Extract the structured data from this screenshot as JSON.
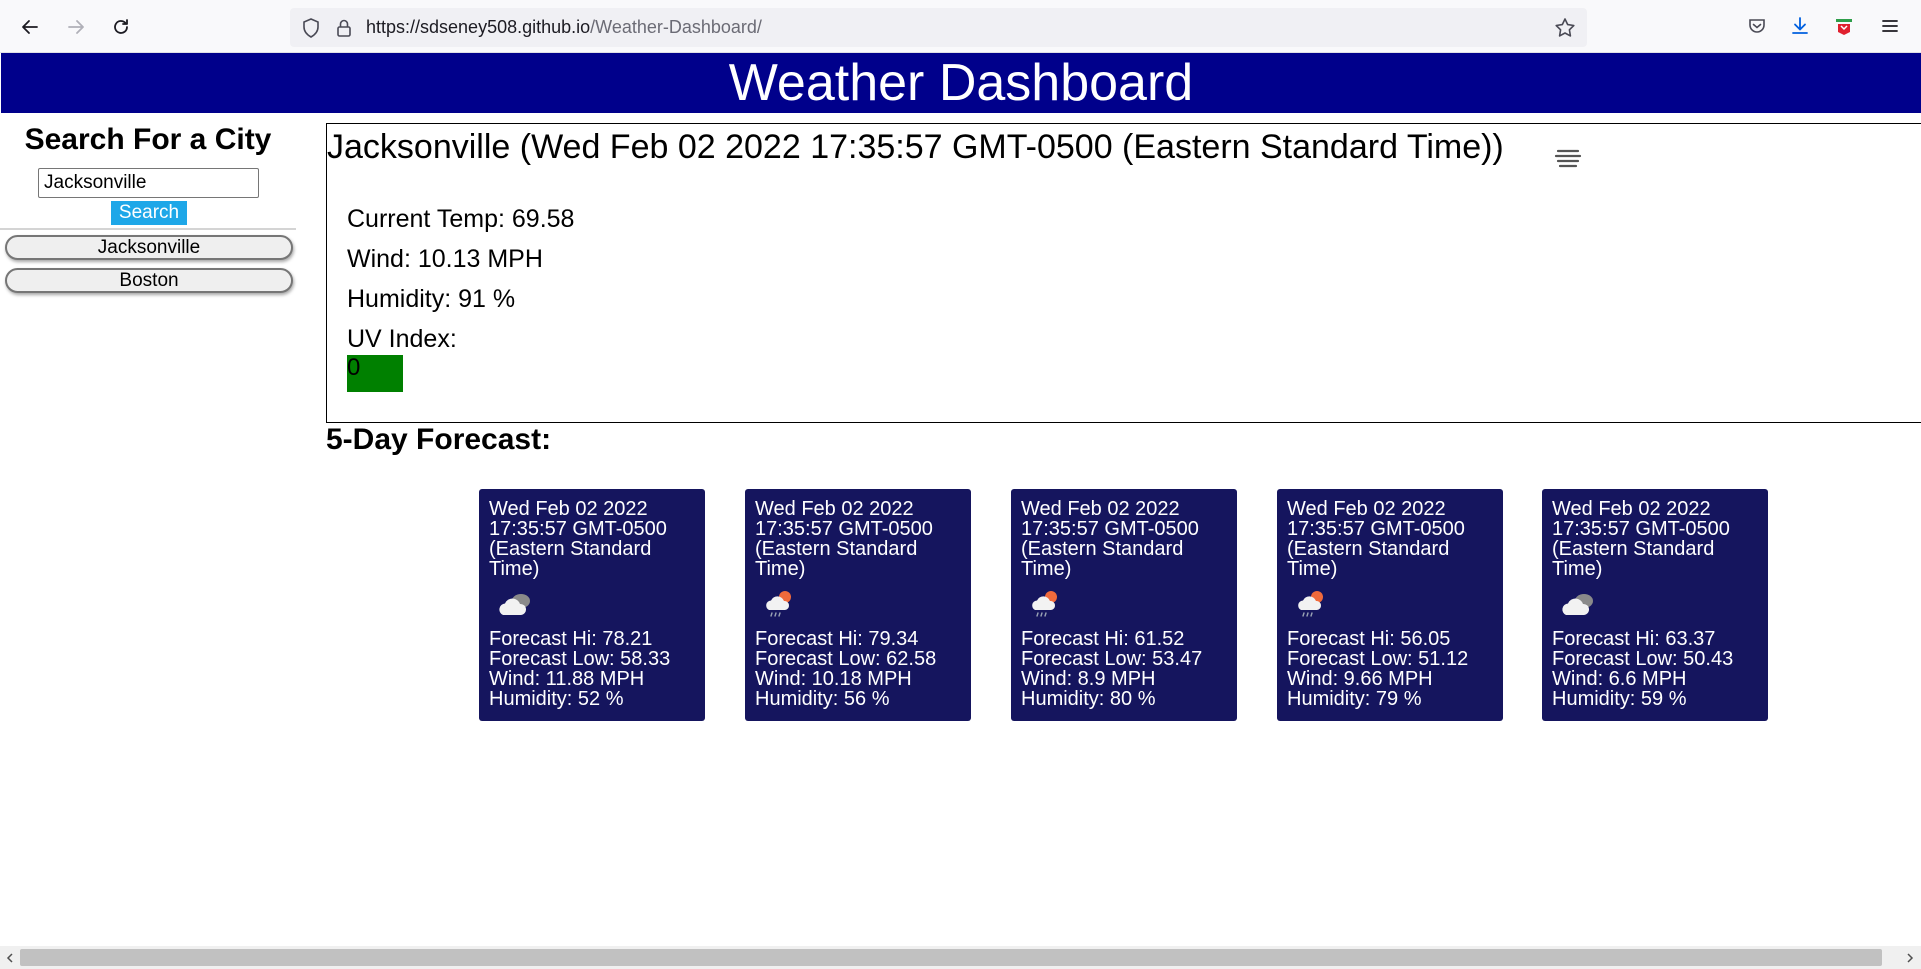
{
  "browser": {
    "url_host": "https://sdseney508.github.io",
    "url_path": "/Weather-Dashboard/"
  },
  "header": {
    "title": "Weather Dashboard"
  },
  "sidebar": {
    "title": "Search For a City",
    "search_value": "Jacksonville",
    "search_button_label": "Search",
    "history": [
      "Jacksonville",
      "Boston"
    ]
  },
  "current": {
    "title": "Jacksonville (Wed Feb 02 2022 17:35:57 GMT-0500 (Eastern Standard Time))",
    "icon": "mist-icon",
    "temp": "Current Temp: 69.58",
    "wind": "Wind: 10.13 MPH",
    "humidity": "Humidity: 91 %",
    "uv_label": "UV Index:",
    "uv_value": "0",
    "uv_color": "#008000"
  },
  "forecast": {
    "title": "5-Day Forecast:",
    "card_color": "#15155e",
    "days": [
      {
        "date": "Wed Feb 02 2022 17:35:57 GMT-0500 (Eastern Standard Time)",
        "icon": "cloudy-icon",
        "hi": "Forecast Hi: 78.21",
        "low": "Forecast Low: 58.33",
        "wind": "Wind: 11.88 MPH",
        "humidity": "Humidity: 52 %"
      },
      {
        "date": "Wed Feb 02 2022 17:35:57 GMT-0500 (Eastern Standard Time)",
        "icon": "sun-rain-icon",
        "hi": "Forecast Hi: 79.34",
        "low": "Forecast Low: 62.58",
        "wind": "Wind: 10.18 MPH",
        "humidity": "Humidity: 56 %"
      },
      {
        "date": "Wed Feb 02 2022 17:35:57 GMT-0500 (Eastern Standard Time)",
        "icon": "sun-rain-icon",
        "hi": "Forecast Hi: 61.52",
        "low": "Forecast Low: 53.47",
        "wind": "Wind: 8.9 MPH",
        "humidity": "Humidity: 80 %"
      },
      {
        "date": "Wed Feb 02 2022 17:35:57 GMT-0500 (Eastern Standard Time)",
        "icon": "sun-rain-icon",
        "hi": "Forecast Hi: 56.05",
        "low": "Forecast Low: 51.12",
        "wind": "Wind: 9.66 MPH",
        "humidity": "Humidity: 79 %"
      },
      {
        "date": "Wed Feb 02 2022 17:35:57 GMT-0500 (Eastern Standard Time)",
        "icon": "cloudy-icon",
        "hi": "Forecast Hi: 63.37",
        "low": "Forecast Low: 50.43",
        "wind": "Wind: 6.6 MPH",
        "humidity": "Humidity: 59 %"
      }
    ]
  }
}
